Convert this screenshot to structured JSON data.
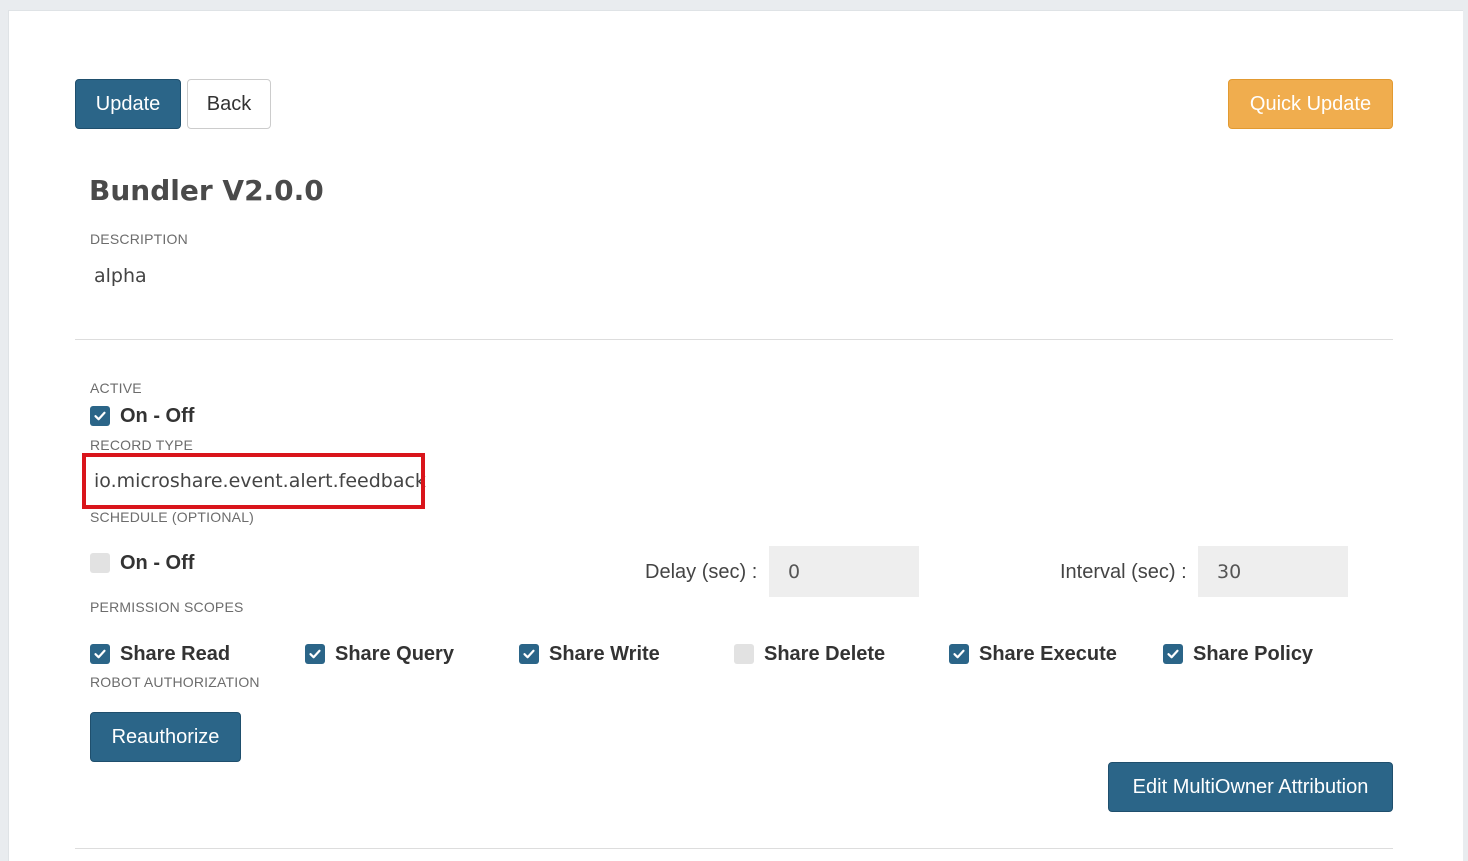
{
  "toolbar": {
    "update_label": "Update",
    "back_label": "Back",
    "quick_update_label": "Quick Update"
  },
  "robot": {
    "title": "Bundler V2.0.0",
    "description_label": "DESCRIPTION",
    "description": "alpha"
  },
  "active": {
    "label": "ACTIVE",
    "toggle_label": "On - Off",
    "checked": true
  },
  "record_type": {
    "label": "RECORD TYPE",
    "value": "io.microshare.event.alert.feedback"
  },
  "schedule": {
    "label": "SCHEDULE (OPTIONAL)",
    "toggle_label": "On - Off",
    "checked": false,
    "delay_label": "Delay (sec) :",
    "delay_value": "0",
    "interval_label": "Interval (sec) :",
    "interval_value": "30"
  },
  "permission_scopes": {
    "label": "PERMISSION SCOPES",
    "items": [
      {
        "label": "Share Read",
        "checked": true
      },
      {
        "label": "Share Query",
        "checked": true
      },
      {
        "label": "Share Write",
        "checked": true
      },
      {
        "label": "Share Delete",
        "checked": false
      },
      {
        "label": "Share Execute",
        "checked": true
      },
      {
        "label": "Share Policy",
        "checked": true
      }
    ]
  },
  "robot_authorization": {
    "label": "ROBOT AUTHORIZATION",
    "reauthorize_label": "Reauthorize"
  },
  "multiowner": {
    "button_label": "Edit MultiOwner Attribution"
  },
  "colors": {
    "primary": "#2b6588",
    "warning": "#f0ad4e",
    "highlight": "#d9151b"
  }
}
